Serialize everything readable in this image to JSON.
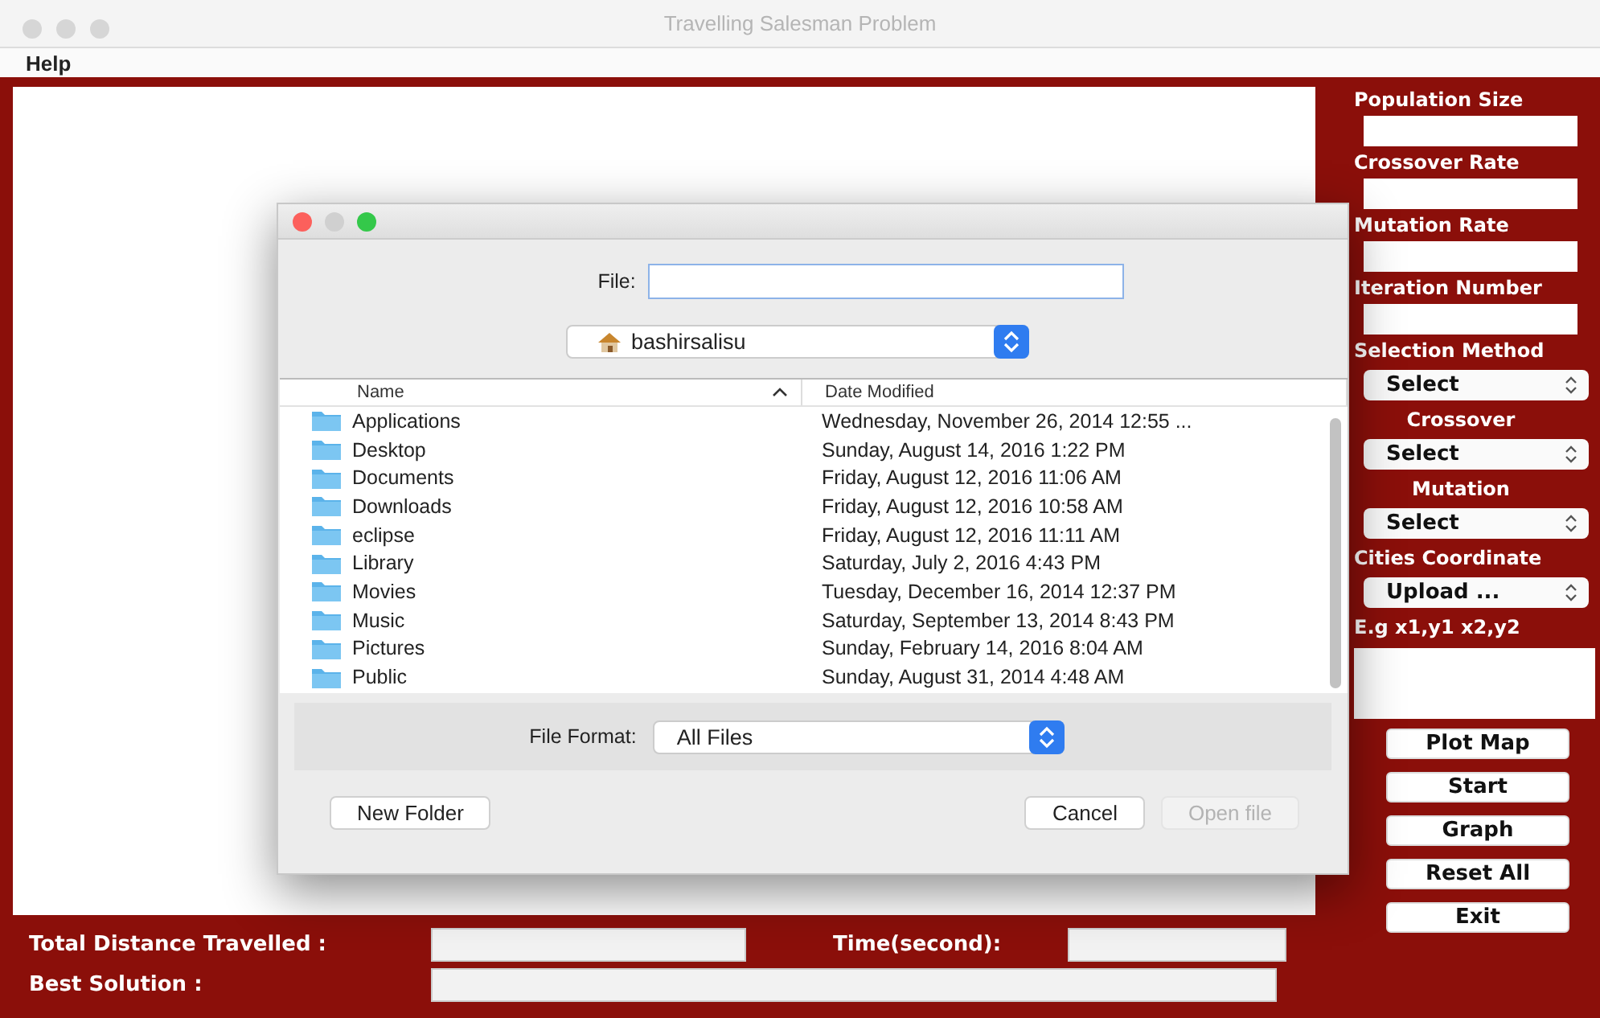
{
  "window": {
    "title": "Travelling Salesman Problem"
  },
  "menu": [
    "Help"
  ],
  "settings": [
    {
      "kind": "field",
      "label": "Population Size"
    },
    {
      "kind": "field",
      "label": "Crossover Rate"
    },
    {
      "kind": "field",
      "label": "Mutation Rate"
    },
    {
      "kind": "field",
      "label": "Iteration Number"
    },
    {
      "kind": "select",
      "label": "Selection Method",
      "value": "Select"
    },
    {
      "kind": "select",
      "label": "Crossover",
      "value": "Select"
    },
    {
      "kind": "select",
      "label": "Mutation",
      "value": "Select"
    },
    {
      "kind": "select",
      "label": "Cities Coordinate",
      "value": "Upload ..."
    }
  ],
  "coordinates_hint": "E.g x1,y1  x2,y2",
  "actions": [
    "Plot Map",
    "Start",
    "Graph",
    "Reset All",
    "Exit"
  ],
  "results": {
    "distance_label": "Total Distance Travelled :",
    "time_label": "Time(second):",
    "best_label": "Best Solution :"
  },
  "dialog": {
    "file_label": "File:",
    "location": "bashirsalisu",
    "columns": [
      "Name",
      "Date Modified"
    ],
    "rows": [
      {
        "name": "Applications",
        "modified": "Wednesday, November 26, 2014 12:55 ..."
      },
      {
        "name": "Desktop",
        "modified": "Sunday, August 14, 2016 1:22 PM"
      },
      {
        "name": "Documents",
        "modified": "Friday, August 12, 2016 11:06 AM"
      },
      {
        "name": "Downloads",
        "modified": "Friday, August 12, 2016 10:58 AM"
      },
      {
        "name": "eclipse",
        "modified": "Friday, August 12, 2016 11:11 AM"
      },
      {
        "name": "Library",
        "modified": "Saturday, July 2, 2016 4:43 PM"
      },
      {
        "name": "Movies",
        "modified": "Tuesday, December 16, 2014 12:37 PM"
      },
      {
        "name": "Music",
        "modified": "Saturday, September 13, 2014 8:43 PM"
      },
      {
        "name": "Pictures",
        "modified": "Sunday, February 14, 2016 8:04 AM"
      },
      {
        "name": "Public",
        "modified": "Sunday, August 31, 2014 4:48 AM"
      }
    ],
    "format_label": "File Format:",
    "format_value": "All Files",
    "buttons": [
      {
        "label": "New Folder",
        "disabled": false
      },
      {
        "label": "Cancel",
        "disabled": false
      },
      {
        "label": "Open file",
        "disabled": true
      }
    ]
  }
}
